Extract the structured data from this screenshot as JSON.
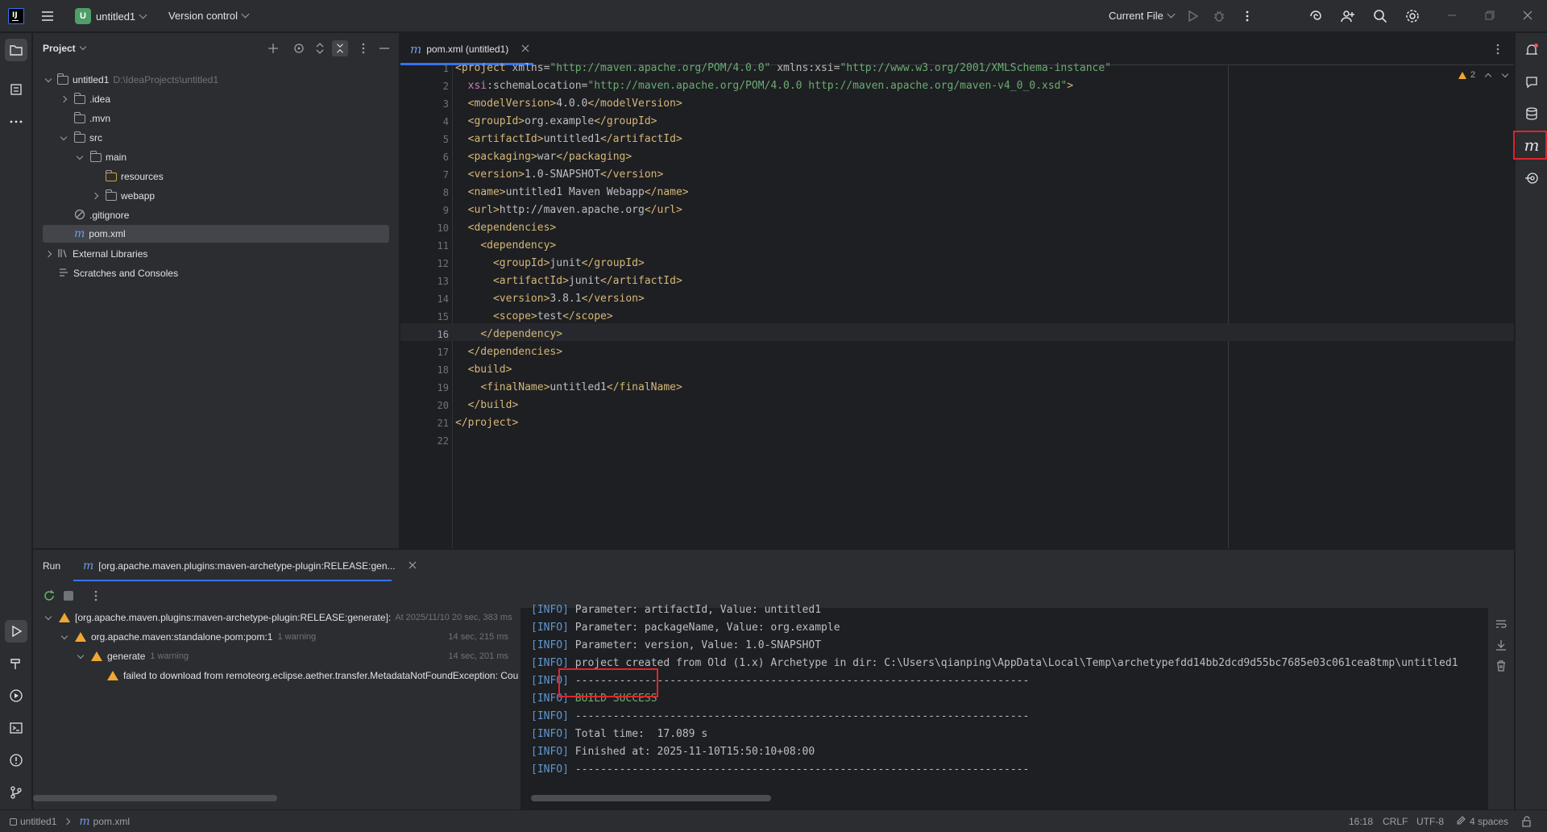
{
  "titlebar": {
    "project_badge": "U",
    "project_name": "untitled1",
    "vcs": "Version control",
    "run_config": "Current File"
  },
  "project_panel": {
    "title": "Project",
    "tree": [
      {
        "label": "untitled1",
        "path": "D:\\IdeaProjects\\untitled1"
      },
      {
        "label": ".idea"
      },
      {
        "label": ".mvn"
      },
      {
        "label": "src"
      },
      {
        "label": "main"
      },
      {
        "label": "resources"
      },
      {
        "label": "webapp"
      },
      {
        "label": ".gitignore"
      },
      {
        "label": "pom.xml"
      },
      {
        "label": "External Libraries"
      },
      {
        "label": "Scratches and Consoles"
      }
    ]
  },
  "editor": {
    "tab_label": "pom.xml (untitled1)",
    "tab_icon": "m",
    "warnings_count": "2",
    "current_line": 16,
    "lines": [
      "<project xmlns=\"http://maven.apache.org/POM/4.0.0\" xmlns:xsi=\"http://www.w3.org/2001/XMLSchema-instance\"",
      "  xsi:schemaLocation=\"http://maven.apache.org/POM/4.0.0 http://maven.apache.org/maven-v4_0_0.xsd\">",
      "  <modelVersion>4.0.0</modelVersion>",
      "  <groupId>org.example</groupId>",
      "  <artifactId>untitled1</artifactId>",
      "  <packaging>war</packaging>",
      "  <version>1.0-SNAPSHOT</version>",
      "  <name>untitled1 Maven Webapp</name>",
      "  <url>http://maven.apache.org</url>",
      "  <dependencies>",
      "    <dependency>",
      "      <groupId>junit</groupId>",
      "      <artifactId>junit</artifactId>",
      "      <version>3.8.1</version>",
      "      <scope>test</scope>",
      "    </dependency>",
      "  </dependencies>",
      "  <build>",
      "    <finalName>untitled1</finalName>",
      "  </build>",
      "</project>",
      ""
    ]
  },
  "run_panel": {
    "run_tab": "Run",
    "config_tab": "[org.apache.maven.plugins:maven-archetype-plugin:RELEASE:gen...",
    "tree": [
      {
        "label": "[org.apache.maven.plugins:maven-archetype-plugin:RELEASE:generate]:",
        "extra": "At 2025/11/10 20 sec, 383 ms"
      },
      {
        "label": "org.apache.maven:standalone-pom:pom:1",
        "extra": "1 warning",
        "time": "14 sec, 215 ms"
      },
      {
        "label": "generate",
        "extra": "1 warning",
        "time": "14 sec, 201 ms"
      },
      {
        "label": "failed to download from remoteorg.eclipse.aether.transfer.MetadataNotFoundException: Coulc"
      }
    ],
    "console": [
      {
        "tag": "[INFO]",
        "text": " Parameter: artifactId, Value: untitled1"
      },
      {
        "tag": "[INFO]",
        "text": " Parameter: packageName, Value: org.example"
      },
      {
        "tag": "[INFO]",
        "text": " Parameter: version, Value: 1.0-SNAPSHOT"
      },
      {
        "tag": "[INFO]",
        "text": " project created from Old (1.x) Archetype in dir: C:\\Users\\qianping\\AppData\\Local\\Temp\\archetypefdd14bb2dcd9d55bc7685e03c061cea8tmp\\untitled1"
      },
      {
        "tag": "[INFO]",
        "text": " ------------------------------------------------------------------------"
      },
      {
        "tag": "[INFO]",
        "text": " BUILD SUCCESS"
      },
      {
        "tag": "[INFO]",
        "text": " ------------------------------------------------------------------------"
      },
      {
        "tag": "[INFO]",
        "text": " Total time:  17.089 s"
      },
      {
        "tag": "[INFO]",
        "text": " Finished at: 2025-11-10T15:50:10+08:00"
      },
      {
        "tag": "[INFO]",
        "text": " ------------------------------------------------------------------------"
      }
    ]
  },
  "statusbar": {
    "project": "untitled1",
    "file": "pom.xml",
    "position": "16:18",
    "line_sep": "CRLF",
    "encoding": "UTF-8",
    "indent": "4 spaces"
  },
  "colors": {
    "accent_success": "#6aab73",
    "highlight_box": "#e0242c",
    "warning": "#f0a732"
  }
}
